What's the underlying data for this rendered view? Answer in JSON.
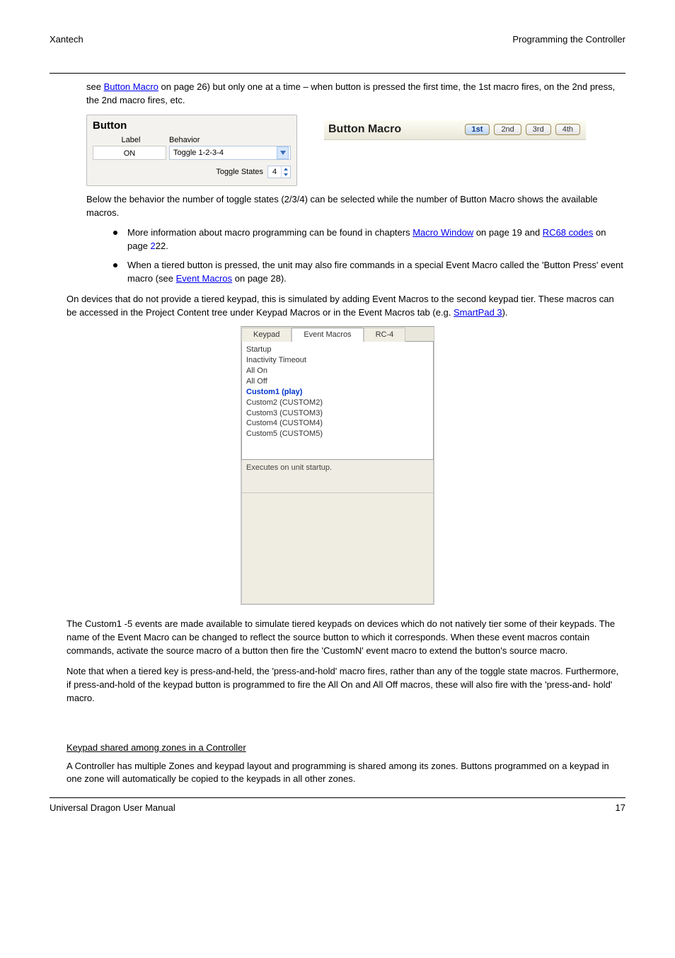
{
  "header": {
    "left": "Xantech",
    "right": "Programming the Controller"
  },
  "first_para_prefix": "see ",
  "first_para_link": "Button Macro",
  "first_para_rest": " on page 26) but only one at a time – when button is pressed the first time, the 1st macro fires, on the 2nd press, the 2nd macro fires, etc.",
  "button_box": {
    "title": "Button",
    "label_header": "Label",
    "behavior_header": "Behavior",
    "label_value": "ON",
    "behavior_value": "Toggle 1-2-3-4",
    "toggle_states_label": "Toggle States",
    "toggle_states_value": "4"
  },
  "macro_tabs": {
    "title": "Button Macro",
    "tabs": [
      "1st",
      "2nd",
      "3rd",
      "4th"
    ],
    "active_index": 0
  },
  "below_figs_para": "Below the behavior the number of toggle states (2/3/4) can be selected while the number of Button Macro shows the available macros.",
  "bullet_more_info": "More information about macro programming can be found in chapters ",
  "bullet_fire_cmds": "When a tiered button is pressed, the unit may also fire commands in a special Event Macro called the 'Button Press' event macro (see ",
  "link_macro_window": "Macro Window",
  "link_rc68": "RC68 codes",
  "text_on_page19_and": " on page 19 and ",
  "text_on_page": " on page ",
  "text_22_period": "22.",
  "link_event_macros": "Event Macros",
  "text_on_page28_paren": " on page 28).",
  "event_macros_intro": "On devices that do not provide a tiered keypad, this is simulated by adding Event Macros to the second keypad tier. These macros can be accessed in the Project Content tree under Keypad Macros or in the Event Macros tab (e.g. ",
  "link_smartpad3": "SmartPad 3",
  "text_smartpad_paren": ").",
  "evm": {
    "tabs": [
      "Keypad",
      "Event Macros",
      "RC-4"
    ],
    "active_tab_index": 1,
    "items": [
      "Startup",
      "Inactivity Timeout",
      "All On",
      "All Off",
      "Custom1 (play)",
      "Custom2 (CUSTOM2)",
      "Custom3 (CUSTOM3)",
      "Custom4 (CUSTOM4)",
      "Custom5 (CUSTOM5)"
    ],
    "selected_index": 4,
    "hint": "Executes on unit startup."
  },
  "custom_para": "The Custom1 -5 events are made available to simulate tiered keypads on devices which do not natively tier some of their keypads. The name of the Event Macro can be changed to reflect the source button to which it corresponds. When these event macros contain commands, activate the source macro of a button then fire the 'CustomN' event macro to extend the button's source macro.",
  "note_para": "Note that when a tiered key is press-and-held, the 'press-and-hold' macro fires, rather than any of the toggle state macros. Furthermore, if press-and-hold of the keypad button is programmed to fire the All On and All Off macros, these will also fire with the 'press-and- hold' macro.",
  "section_heading": "Keypad shared among zones in a Controller",
  "shared_para": "A Controller has multiple Zones and keypad layout and programming is shared among its zones. Buttons programmed on a keypad in one zone will automatically be copied to the keypads in all other zones.",
  "footer": {
    "left": "Universal Dragon User Manual",
    "right": "17"
  }
}
